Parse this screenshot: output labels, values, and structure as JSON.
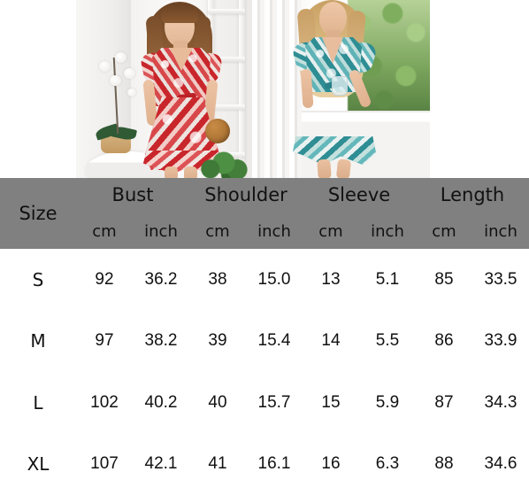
{
  "product_images": {
    "left": {
      "alt": "model-in-red-floral-boho-wrap-dress-indoor",
      "dress_color": "#cf3237",
      "setting": "white interior room with orchid plant and ladder shelf"
    },
    "right": {
      "alt": "model-in-teal-floral-boho-wrap-dress-outdoor",
      "dress_color": "#3f9aa1",
      "setting": "bright room with window onto green foliage"
    }
  },
  "size_chart": {
    "header_background": "#808080",
    "size_label": "Size",
    "measurement_groups": [
      {
        "name": "Bust",
        "units": [
          "cm",
          "inch"
        ]
      },
      {
        "name": "Shoulder",
        "units": [
          "cm",
          "inch"
        ]
      },
      {
        "name": "Sleeve",
        "units": [
          "cm",
          "inch"
        ]
      },
      {
        "name": "Length",
        "units": [
          "cm",
          "inch"
        ]
      }
    ],
    "rows": [
      {
        "size": "S",
        "bust_cm": "92",
        "bust_inch": "36.2",
        "shoulder_cm": "38",
        "shoulder_inch": "15.0",
        "sleeve_cm": "13",
        "sleeve_inch": "5.1",
        "length_cm": "85",
        "length_inch": "33.5"
      },
      {
        "size": "M",
        "bust_cm": "97",
        "bust_inch": "38.2",
        "shoulder_cm": "39",
        "shoulder_inch": "15.4",
        "sleeve_cm": "14",
        "sleeve_inch": "5.5",
        "length_cm": "86",
        "length_inch": "33.9"
      },
      {
        "size": "L",
        "bust_cm": "102",
        "bust_inch": "40.2",
        "shoulder_cm": "40",
        "shoulder_inch": "15.7",
        "sleeve_cm": "15",
        "sleeve_inch": "5.9",
        "length_cm": "87",
        "length_inch": "34.3"
      },
      {
        "size": "XL",
        "bust_cm": "107",
        "bust_inch": "42.1",
        "shoulder_cm": "41",
        "shoulder_inch": "16.1",
        "sleeve_cm": "16",
        "sleeve_inch": "6.3",
        "length_cm": "88",
        "length_inch": "34.6"
      }
    ]
  }
}
